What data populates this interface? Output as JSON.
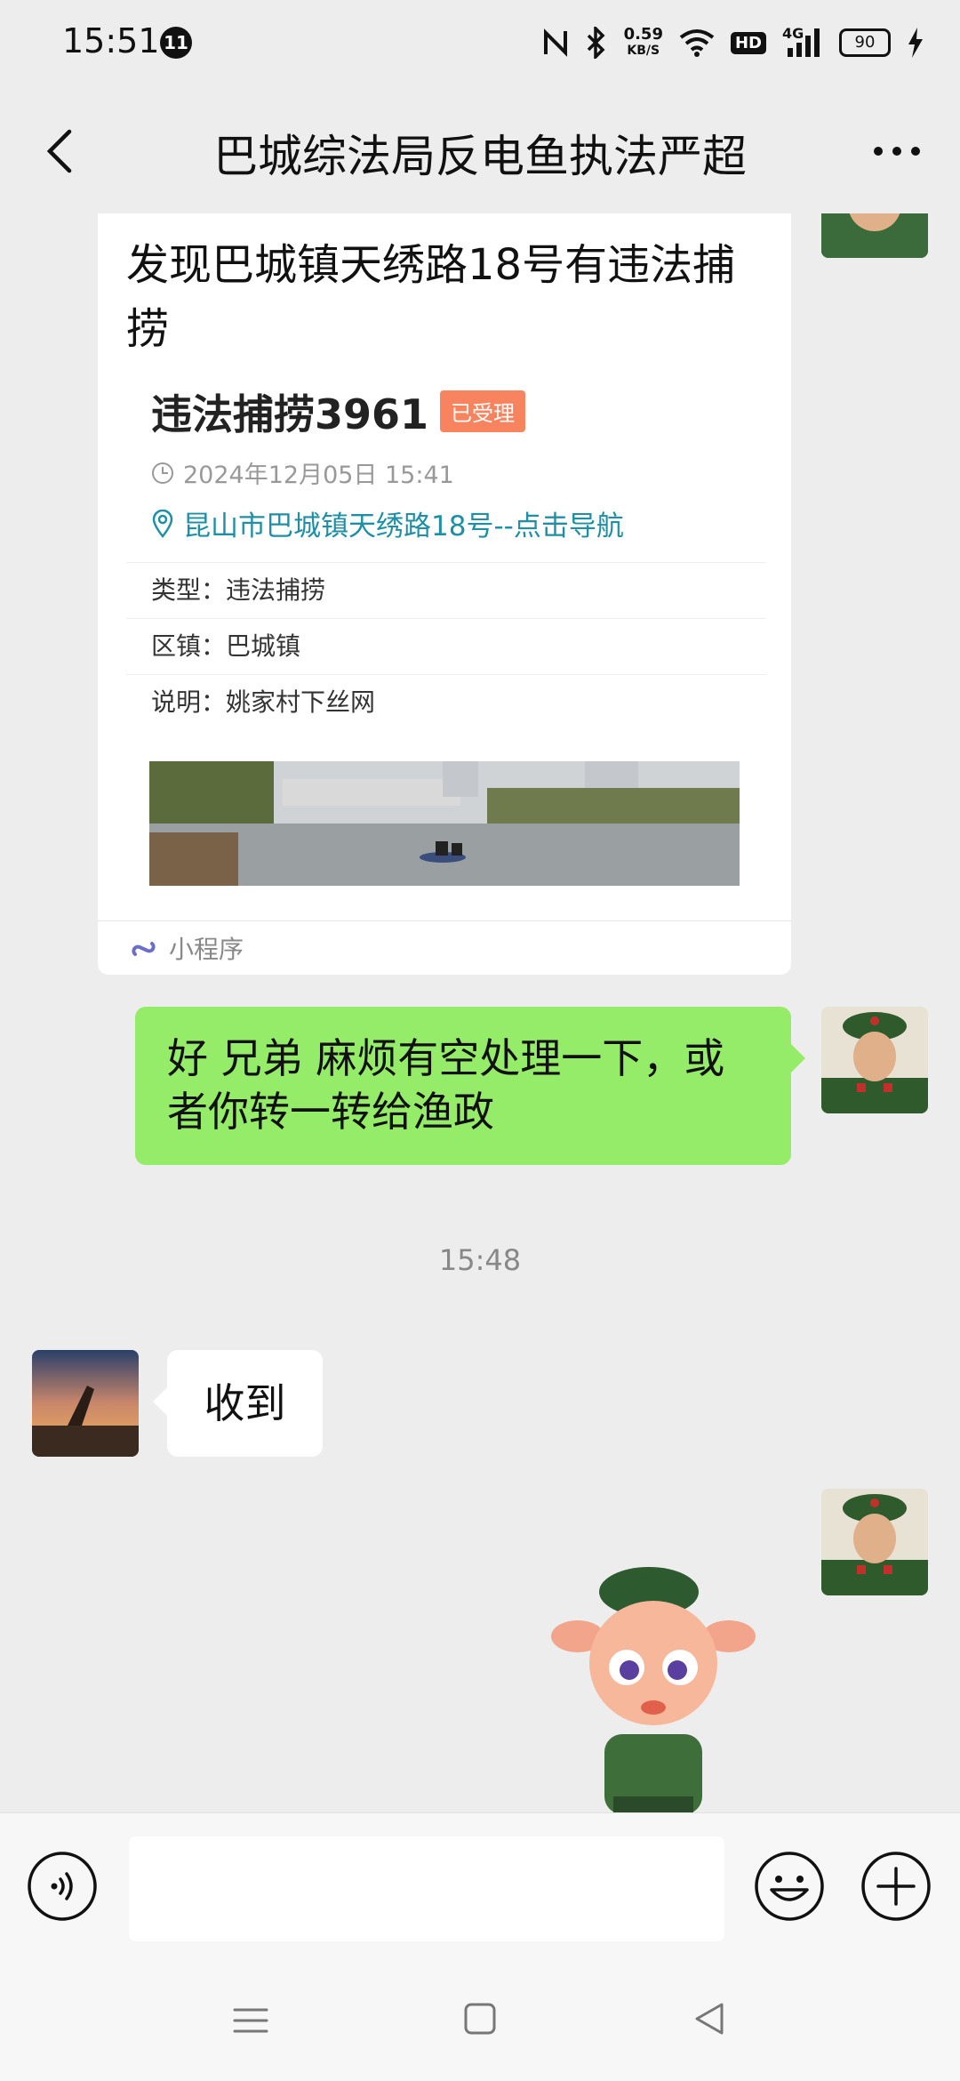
{
  "status_bar": {
    "time": "15:51",
    "notification_count": "11",
    "net_speed_value": "0.59",
    "net_speed_unit": "KB/S",
    "hd_label": "HD",
    "network_label": "4G",
    "battery": "90"
  },
  "header": {
    "title": "巴城综法局反电鱼执法严超"
  },
  "chat": {
    "card": {
      "title": "发现巴城镇天绣路18号有违法捕捞",
      "case_title": "违法捕捞3961",
      "case_status": "已受理",
      "time": "2024年12月05日 15:41",
      "location": "昆山市巴城镇天绣路18号--点击导航",
      "type_label": "类型：",
      "type_value": "违法捕捞",
      "district_label": "区镇：",
      "district_value": "巴城镇",
      "note_label": "说明：",
      "note_value": "姚家村下丝网",
      "footer_label": "小程序"
    },
    "reply_message": "好 兄弟 麻烦有空处理一下，或者你转一转给渔政",
    "timestamp": "15:48",
    "received_message": "收到"
  },
  "input_bar": {
    "placeholder": ""
  },
  "colors": {
    "accent_green": "#95ec69",
    "status_orange": "#f7845e",
    "link_teal": "#1f8fa6",
    "background": "#ededed"
  }
}
